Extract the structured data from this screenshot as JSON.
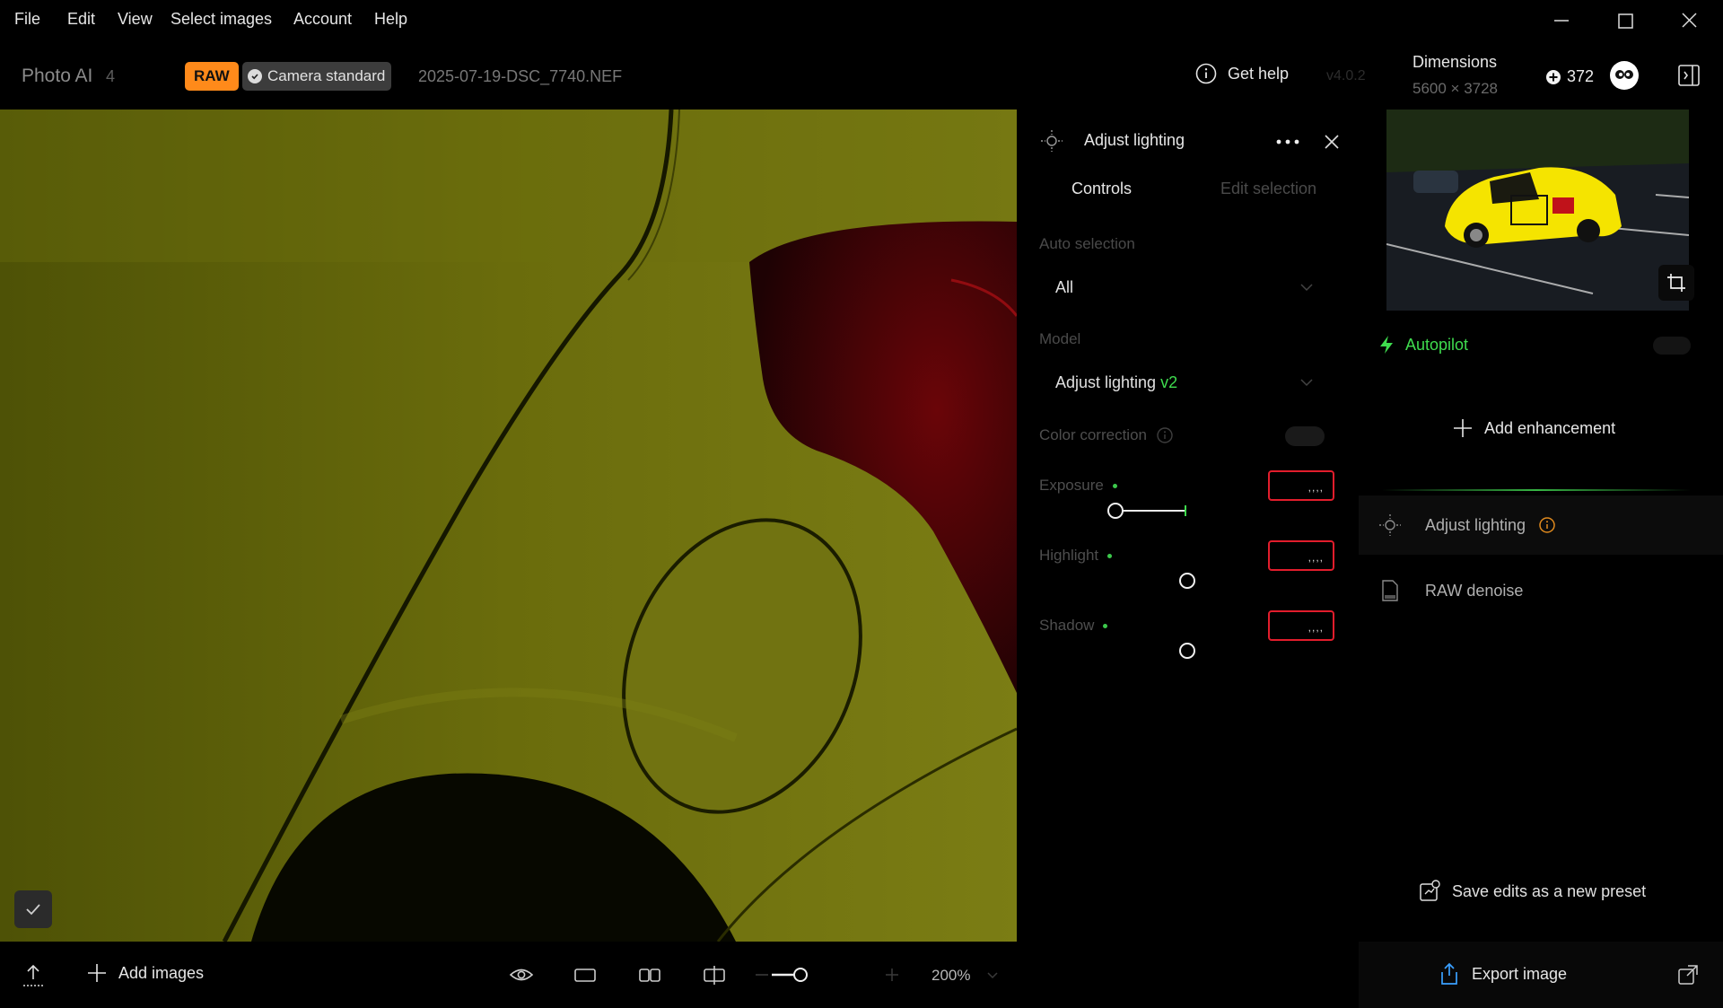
{
  "menu": [
    "File",
    "Edit",
    "View",
    "Select images",
    "Account",
    "Help"
  ],
  "header": {
    "app_name": "Photo AI",
    "app_version": "4",
    "badge_raw": "RAW",
    "badge_profile": "Camera standard",
    "filename": "2025-07-19-DSC_7740.NEF",
    "help_label": "Get help",
    "version_faded": "v4.0.2",
    "dimensions_label": "Dimensions",
    "dimensions_value": "5600 × 3728",
    "credits": "372"
  },
  "adjust_panel": {
    "title": "Adjust lighting",
    "tabs": [
      "Controls",
      "Edit selection"
    ],
    "auto_selection_label": "Auto selection",
    "auto_selection_value": "All",
    "model_label": "Model",
    "model_value": "Adjust lighting",
    "model_version": "v2",
    "color_correction_label": "Color correction",
    "color_correction_on": false,
    "sliders": [
      {
        "label": "Exposure",
        "value_text": ",,,,"
      },
      {
        "label": "Highlight",
        "value_text": ",,,,"
      },
      {
        "label": "Shadow",
        "value_text": ",,,,"
      }
    ]
  },
  "right_panel": {
    "autopilot_label": "Autopilot",
    "autopilot_on": false,
    "add_enhancement_label": "Add enhancement",
    "enhancements": [
      "Adjust lighting",
      "RAW denoise"
    ],
    "save_preset_label": "Save edits as a new preset",
    "export_label": "Export image"
  },
  "bottom_bar": {
    "add_images_label": "Add images",
    "zoom_level": "200%"
  },
  "colors": {
    "accent_green": "#3fdc4e",
    "raw_badge": "#ff8a1a",
    "value_box_border": "#e21d2c",
    "warning_orange": "#e08a1e"
  },
  "icons": [
    "settings-sun-icon",
    "more-icon",
    "close-icon",
    "chevron-down-icon",
    "info-icon",
    "lightning-icon",
    "plus-icon",
    "document-icon",
    "preset-icon",
    "export-icon",
    "crop-icon",
    "eye-icon",
    "single-view-icon",
    "side-by-side-icon",
    "split-view-icon",
    "upload-icon",
    "check-icon",
    "credit-icon",
    "panel-toggle-icon",
    "minimize-icon",
    "maximize-icon",
    "window-close-icon"
  ]
}
